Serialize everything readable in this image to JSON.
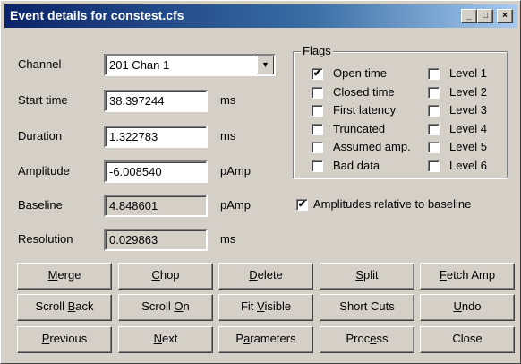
{
  "window": {
    "title": "Event details for constest.cfs",
    "minimize": "_",
    "maximize": "□",
    "close": "×"
  },
  "fields": {
    "channel": {
      "label": "Channel",
      "value": "201 Chan  1"
    },
    "start_time": {
      "label": "Start time",
      "value": "38.397244",
      "unit": "ms"
    },
    "duration": {
      "label": "Duration",
      "value": "1.322783",
      "unit": "ms"
    },
    "amplitude": {
      "label": "Amplitude",
      "value": "-6.008540",
      "unit": "pAmp"
    },
    "baseline": {
      "label": "Baseline",
      "value": "4.848601",
      "unit": "pAmp"
    },
    "resolution": {
      "label": "Resolution",
      "value": "0.029863",
      "unit": "ms"
    }
  },
  "flags": {
    "title": "Flags",
    "left": [
      {
        "label": "Open time",
        "checked": true
      },
      {
        "label": "Closed time",
        "checked": false
      },
      {
        "label": "First latency",
        "checked": false
      },
      {
        "label": "Truncated",
        "checked": false
      },
      {
        "label": "Assumed amp.",
        "checked": false
      },
      {
        "label": "Bad data",
        "checked": false
      }
    ],
    "right": [
      {
        "label": "Level 1",
        "checked": false
      },
      {
        "label": "Level 2",
        "checked": false
      },
      {
        "label": "Level 3",
        "checked": false
      },
      {
        "label": "Level 4",
        "checked": false
      },
      {
        "label": "Level 5",
        "checked": false
      },
      {
        "label": "Level 6",
        "checked": false
      }
    ]
  },
  "relative_baseline": {
    "label": "Amplitudes relative to baseline",
    "checked": true
  },
  "buttons": [
    [
      {
        "pre": "",
        "u": "M",
        "post": "erge"
      },
      {
        "pre": "",
        "u": "C",
        "post": "hop"
      },
      {
        "pre": "",
        "u": "D",
        "post": "elete"
      },
      {
        "pre": "",
        "u": "S",
        "post": "plit"
      },
      {
        "pre": "",
        "u": "F",
        "post": "etch Amp"
      }
    ],
    [
      {
        "pre": "Scroll ",
        "u": "B",
        "post": "ack"
      },
      {
        "pre": "Scroll ",
        "u": "O",
        "post": "n"
      },
      {
        "pre": "Fit ",
        "u": "V",
        "post": "isible"
      },
      {
        "pre": "Short Cuts",
        "u": "",
        "post": ""
      },
      {
        "pre": "",
        "u": "U",
        "post": "ndo"
      }
    ],
    [
      {
        "pre": "",
        "u": "P",
        "post": "revious"
      },
      {
        "pre": "",
        "u": "N",
        "post": "ext"
      },
      {
        "pre": "P",
        "u": "a",
        "post": "rameters"
      },
      {
        "pre": "Proc",
        "u": "e",
        "post": "ss"
      },
      {
        "pre": "Close",
        "u": "",
        "post": ""
      }
    ]
  ]
}
